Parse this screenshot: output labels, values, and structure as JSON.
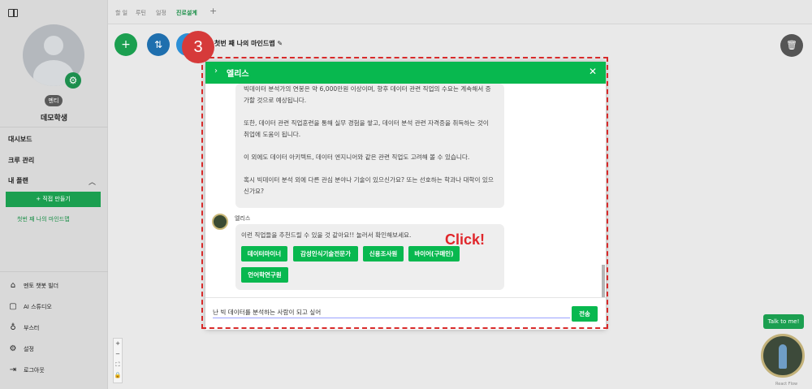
{
  "sidebar": {
    "role_badge": "멘티",
    "username": "데모학생",
    "items": [
      {
        "label": "대시보드"
      },
      {
        "label": "크루 관리"
      },
      {
        "label": "내 플랜"
      }
    ],
    "make_button": "+ 직접 만들기",
    "map_item": "첫번 째 나의 마인드맵",
    "bottom_items": [
      {
        "icon": "robot-icon",
        "label": "멘토 챗봇 빌더"
      },
      {
        "icon": "studio-icon",
        "label": "AI 스튜디오"
      },
      {
        "icon": "booster-icon",
        "label": "부스터"
      },
      {
        "icon": "gear-icon",
        "label": "설정"
      },
      {
        "icon": "logout-icon",
        "label": "로그아웃"
      }
    ]
  },
  "tabs": [
    {
      "label": "할 일"
    },
    {
      "label": "루틴"
    },
    {
      "label": "일정"
    },
    {
      "label": "진로설계"
    },
    {
      "label": "+"
    }
  ],
  "map_title": "첫번 째 나의 마인드맵",
  "step_number": "3",
  "modal": {
    "title": "엘리스",
    "messages": [
      "빅데이터 분석가의 연봉은 약 6,000만원 이상이며, 향후 데이터 관련 직업의 수요는 계속해서 증가할 것으로 예상됩니다.",
      "또한, 데이터 관련 직업훈련을 통해 실무 경험을 쌓고, 데이터 분석 관련 자격증을 취득하는 것이 취업에 도움이 됩니다.",
      "이 외에도 데이터 아키텍트, 데이터 엔지니어와 같은 관련 직업도 고려해 볼 수 있습니다.",
      "혹시 빅데이터 분석 외에 다른 관심 분야나 기술이 있으신가요? 또는 선호하는 학과나 대학이 있으신가요?"
    ],
    "bot_name": "엘리스",
    "bot_message": "이런 직업들을 추천드릴 수 있을 것 같아요!! 눌러서 확인해보세요.",
    "job_buttons": [
      "데이터마이너",
      "감성인식기술전문가",
      "신용조사원",
      "바이어(구매인)",
      "언어학연구원"
    ],
    "input_value": "난 빅 데이터를 분석하는 사람이 되고 싶어",
    "send_label": "전송"
  },
  "click_annotation": "Click!",
  "talk_bubble": "Talk to me!",
  "reactflow": "React Flow",
  "colors": {
    "brand": "#08b84f",
    "annotation": "#d82a2a"
  }
}
